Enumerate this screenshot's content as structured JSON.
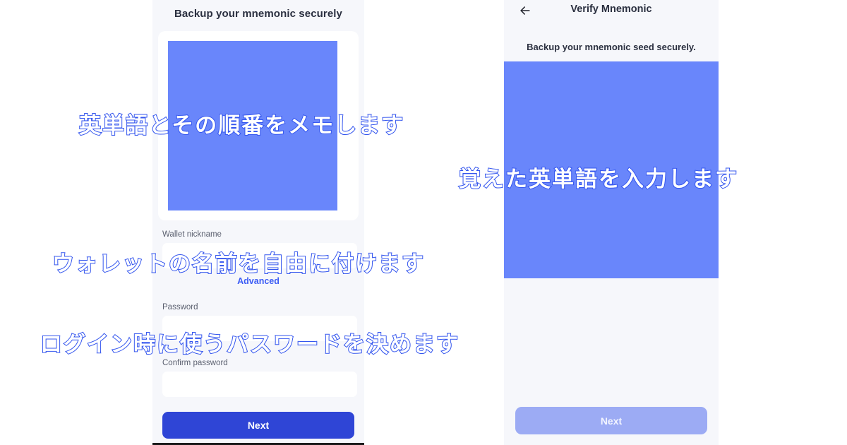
{
  "left_screen": {
    "title": "Backup your mnemonic securely",
    "mnemonic_placeholder_icon": "mnemonic-image-placeholder",
    "fields": [
      {
        "label": "Wallet nickname",
        "value": "",
        "placeholder": ""
      },
      {
        "label": "Password",
        "value": "",
        "placeholder": ""
      },
      {
        "label": "Confirm password",
        "value": "",
        "placeholder": ""
      }
    ],
    "advanced_label": "Advanced",
    "next_label": "Next"
  },
  "right_screen": {
    "back_icon": "arrow-left-icon",
    "title": "Verify Mnemonic",
    "subtitle": "Backup your mnemonic seed securely.",
    "mnemonic_placeholder_icon": "mnemonic-input-placeholder",
    "next_label": "Next"
  },
  "annotations": [
    {
      "text": "英単語とその順番をメモします"
    },
    {
      "text": "ウォレットの名前を自由に付けます"
    },
    {
      "text": "ログイン時に使うパスワードを決めます"
    },
    {
      "text": "覚えた英単語を入力します"
    }
  ],
  "colors": {
    "accent": "#6986fb",
    "primary_button": "#2f45d6",
    "disabled_button": "#9cabf4",
    "link": "#3c5cf5",
    "screen_bg": "#f6f7fb",
    "annotation_outline": "#3355ee",
    "annotation_fill": "#ffffff"
  }
}
